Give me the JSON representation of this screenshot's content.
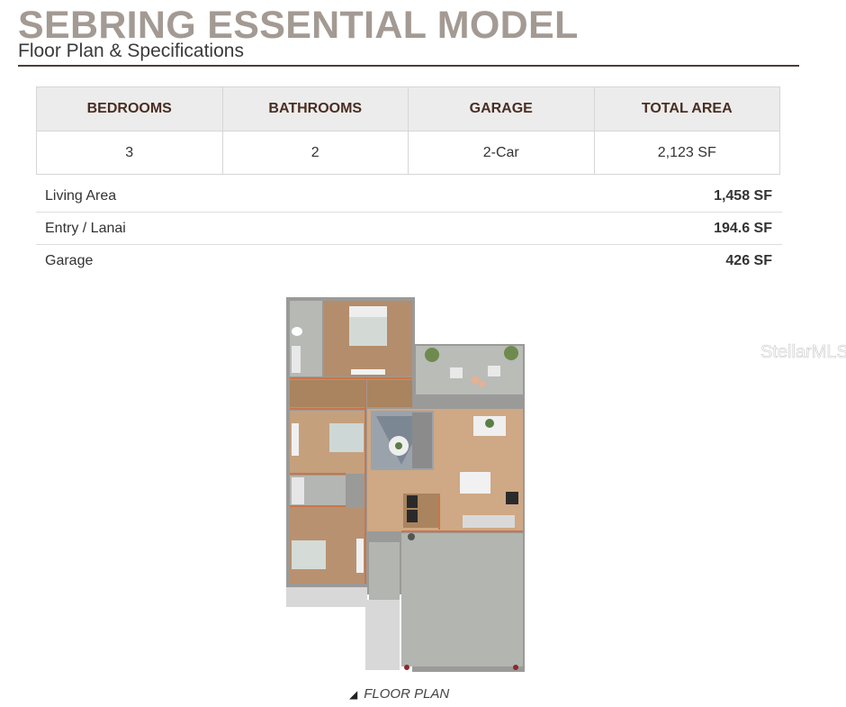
{
  "header": {
    "title": "SEBRING ESSENTIAL MODEL",
    "subtitle": "Floor Plan & Specifications"
  },
  "specs": {
    "headers": [
      "BEDROOMS",
      "BATHROOMS",
      "GARAGE",
      "TOTAL AREA"
    ],
    "values": [
      "3",
      "2",
      "2-Car",
      "2,123 SF"
    ]
  },
  "areas": [
    {
      "label": "Living Area",
      "value": "1,458 SF"
    },
    {
      "label": "Entry / Lanai",
      "value": "194.6 SF"
    },
    {
      "label": "Garage",
      "value": "426 SF"
    }
  ],
  "floor_plan": {
    "caption": "FLOOR PLAN",
    "caption_icon": "triangle-icon",
    "watermark": "StellarMLS"
  },
  "colors": {
    "title": "#a39a93",
    "rule": "#4a3f38",
    "header_text": "#4a2e22",
    "floor_wood": "#c9a27c",
    "wall": "#c8764a"
  }
}
